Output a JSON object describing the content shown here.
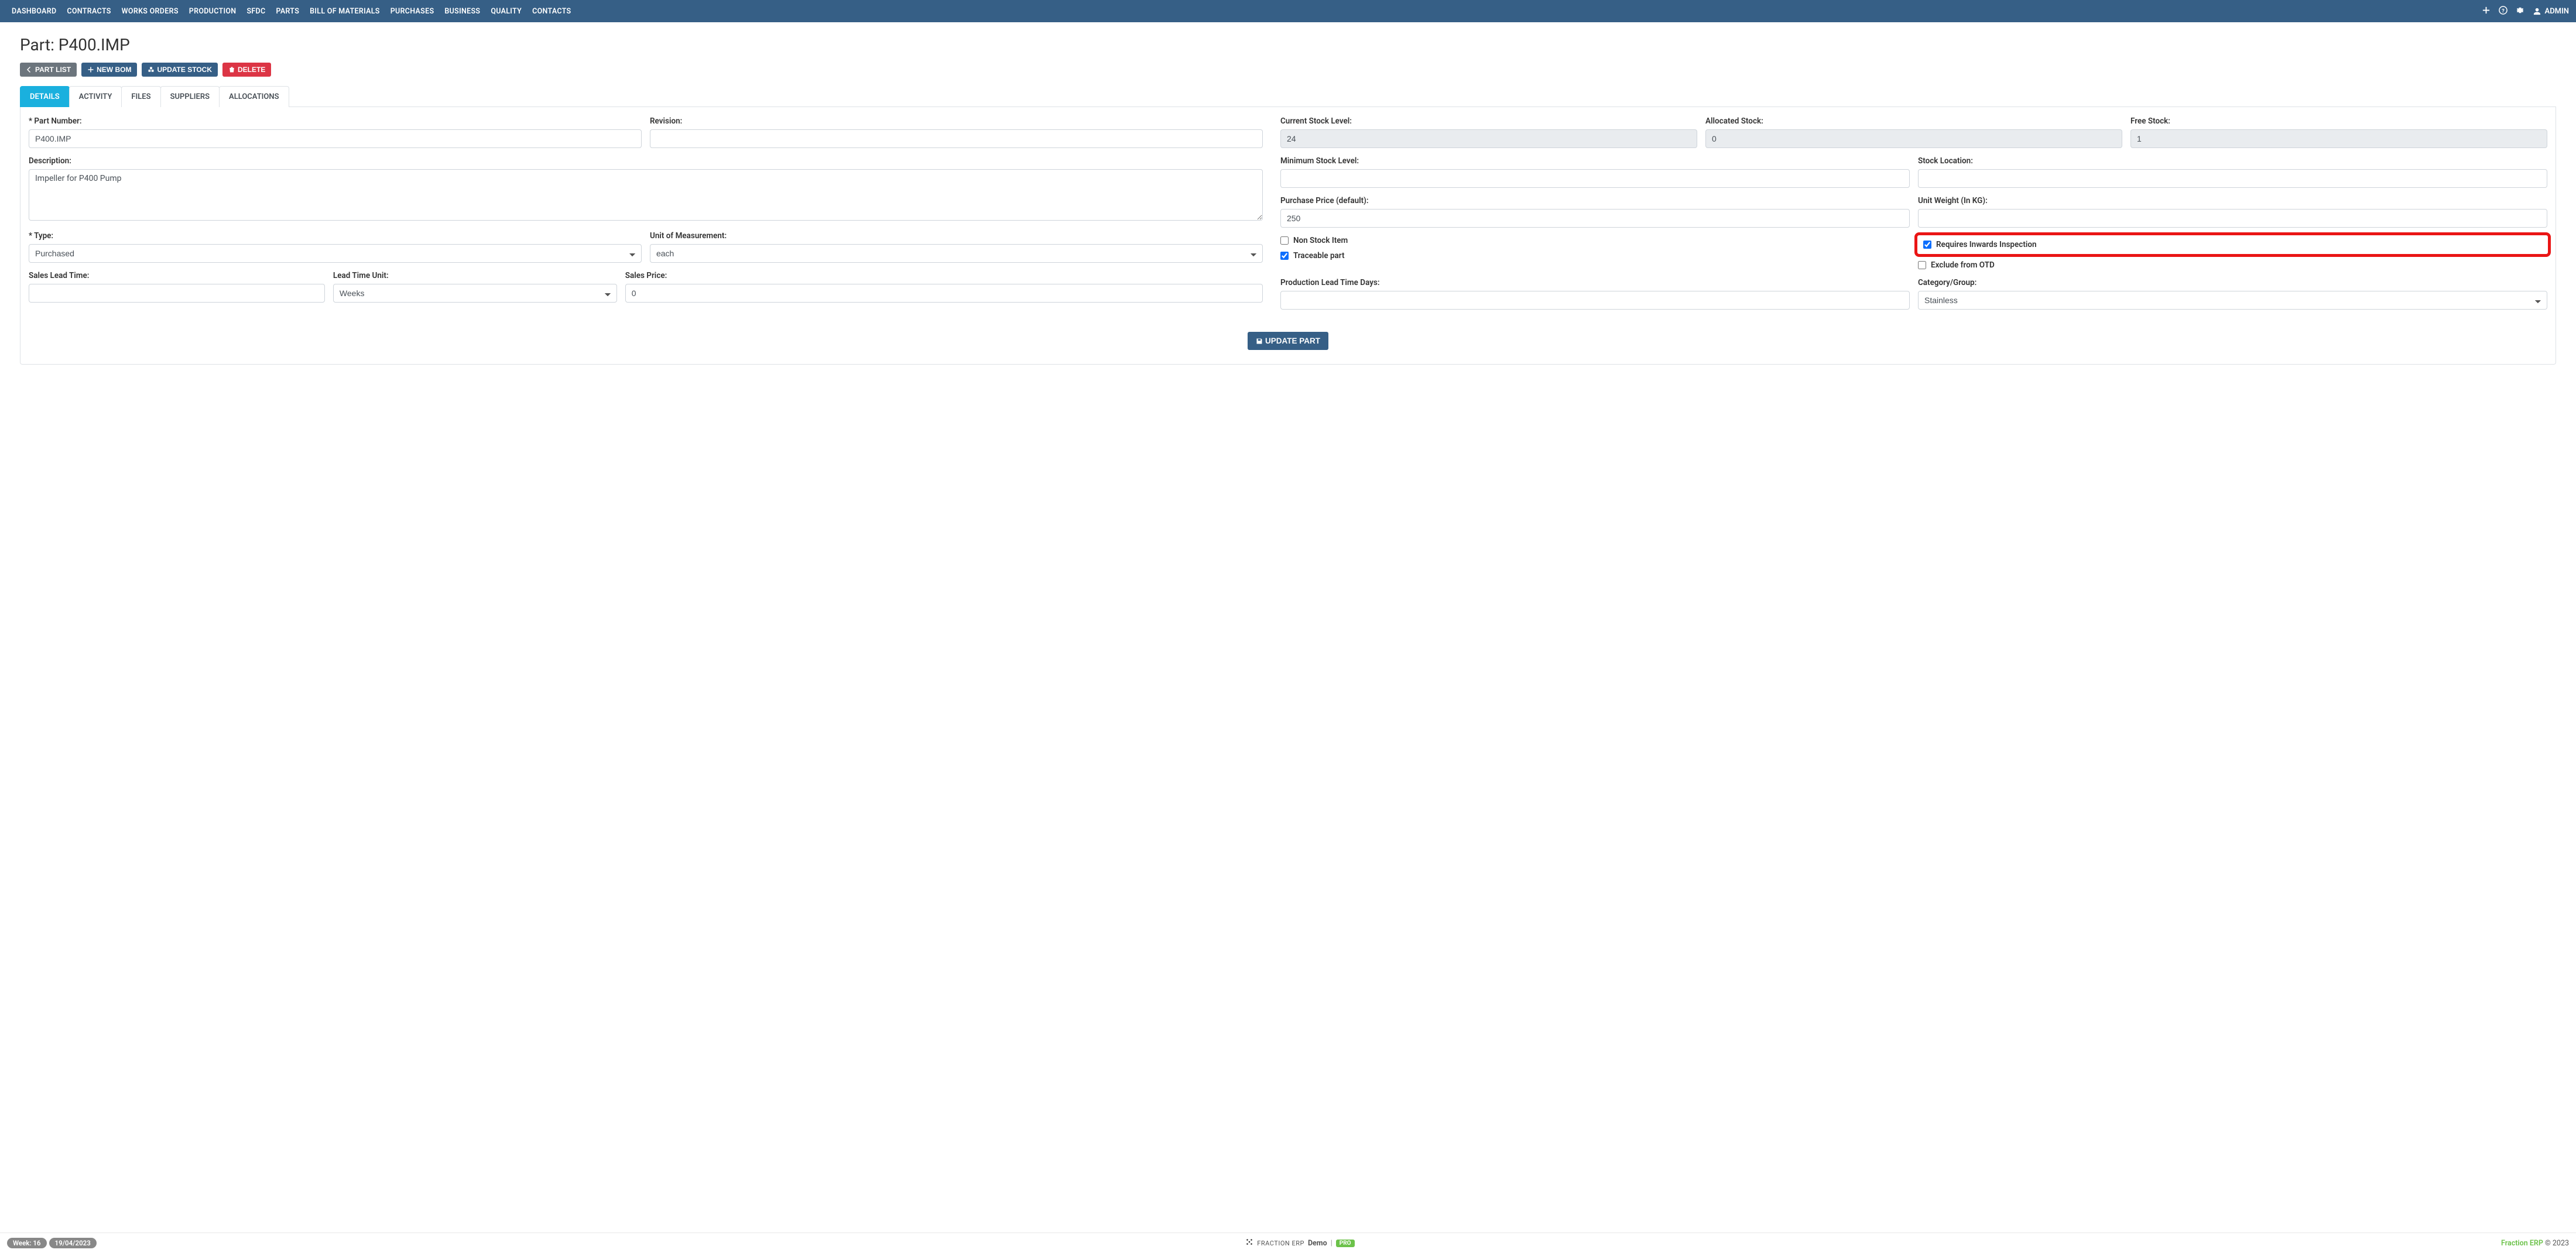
{
  "nav": {
    "items": [
      "DASHBOARD",
      "CONTRACTS",
      "WORKS ORDERS",
      "PRODUCTION",
      "SFDC",
      "PARTS",
      "BILL OF MATERIALS",
      "PURCHASES",
      "BUSINESS",
      "QUALITY",
      "CONTACTS"
    ],
    "admin_label": "ADMIN"
  },
  "page": {
    "title": "Part: P400.IMP"
  },
  "actions": {
    "part_list": "PART LIST",
    "new_bom": "NEW BOM",
    "update_stock": "UPDATE STOCK",
    "delete": "DELETE"
  },
  "tabs": [
    "DETAILS",
    "ACTIVITY",
    "FILES",
    "SUPPLIERS",
    "ALLOCATIONS"
  ],
  "form": {
    "part_number_label": "* Part Number:",
    "part_number": "P400.IMP",
    "revision_label": "Revision:",
    "revision": "",
    "description_label": "Description:",
    "description": "Impeller for P400 Pump",
    "type_label": "* Type:",
    "type": "Purchased",
    "uom_label": "Unit of Measurement:",
    "uom": "each",
    "sales_lead_time_label": "Sales Lead Time:",
    "sales_lead_time": "",
    "lead_time_unit_label": "Lead Time Unit:",
    "lead_time_unit": "Weeks",
    "sales_price_label": "Sales Price:",
    "sales_price": "0",
    "current_stock_label": "Current Stock Level:",
    "current_stock": "24",
    "allocated_stock_label": "Allocated Stock:",
    "allocated_stock": "0",
    "free_stock_label": "Free Stock:",
    "free_stock": "1",
    "min_stock_label": "Minimum Stock Level:",
    "min_stock": "",
    "stock_location_label": "Stock Location:",
    "stock_location": "",
    "purchase_price_label": "Purchase Price (default):",
    "purchase_price": "250",
    "unit_weight_label": "Unit Weight (In KG):",
    "unit_weight": "",
    "non_stock_label": "Non Stock Item",
    "traceable_label": "Traceable part",
    "requires_inspection_label": "Requires Inwards Inspection",
    "exclude_otd_label": "Exclude from OTD",
    "prod_lead_label": "Production Lead Time Days:",
    "prod_lead": "",
    "category_label": "Category/Group:",
    "category": "Stainless",
    "update_button": "UPDATE PART"
  },
  "footer": {
    "week": "Week: 16",
    "date": "19/04/2023",
    "brand_upper": "FRACTION ERP",
    "brand_demo": "Demo",
    "pro": "PRO",
    "right_brand": "Fraction ERP",
    "right_copy": "© 2023"
  }
}
